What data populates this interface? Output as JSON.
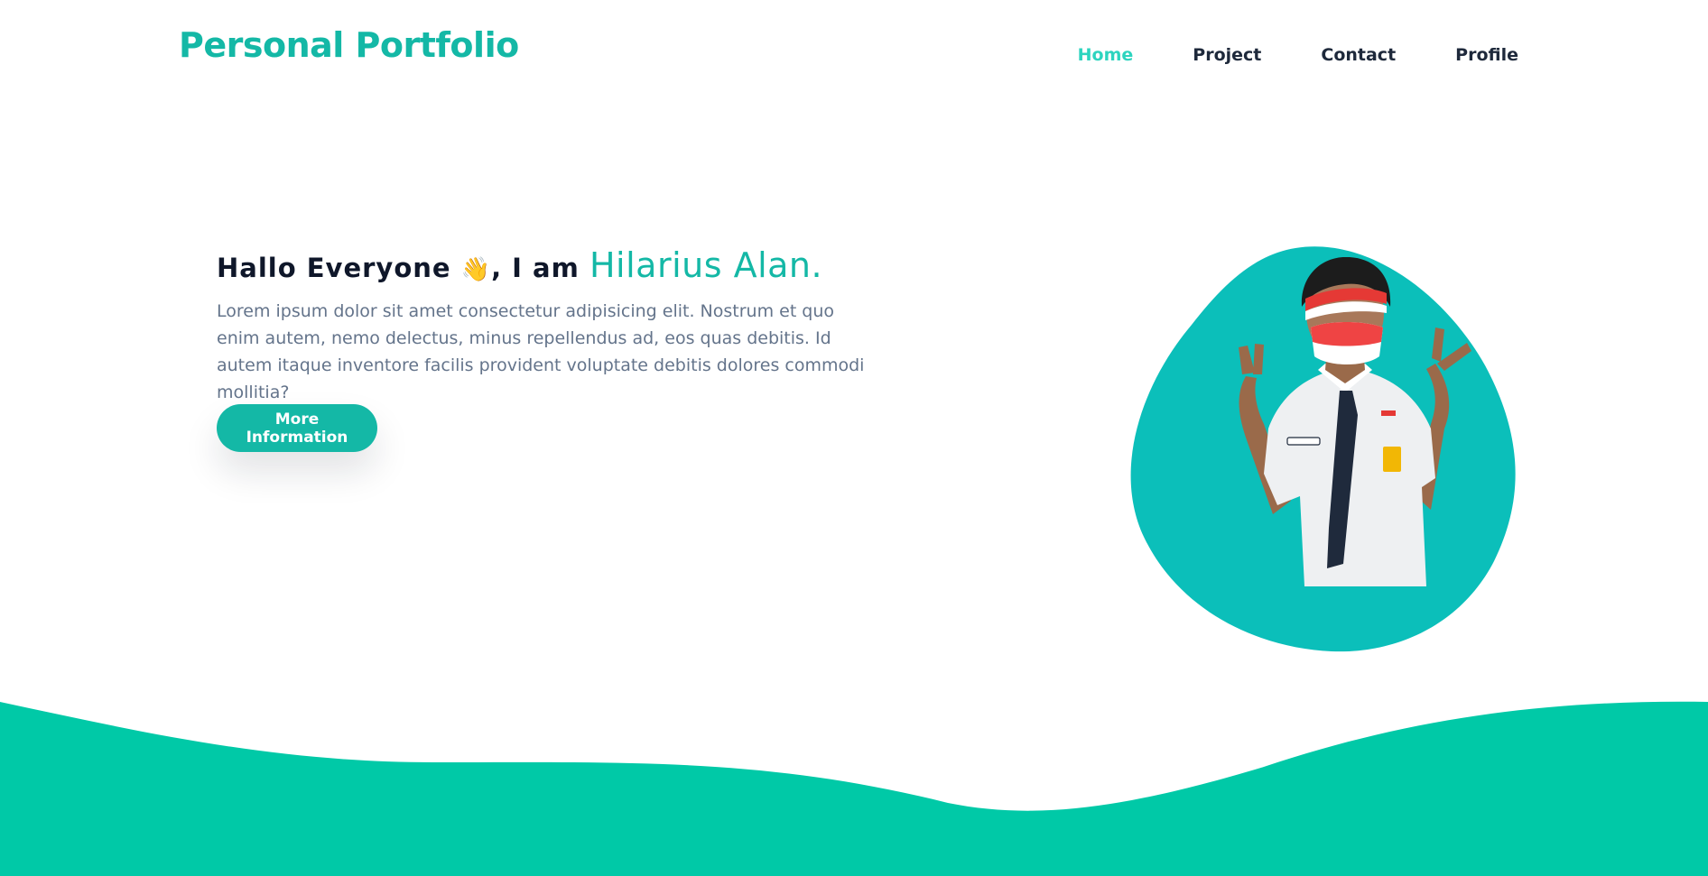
{
  "header": {
    "brand": "Personal Portfolio",
    "nav": [
      {
        "label": "Home",
        "active": true
      },
      {
        "label": "Project",
        "active": false
      },
      {
        "label": "Contact",
        "active": false
      },
      {
        "label": "Profile",
        "active": false
      }
    ]
  },
  "hero": {
    "greeting_prefix": "Hallo Everyone",
    "wave_emoji": "👋",
    "greeting_mid": ", I am",
    "name": "Hilarius Alan.",
    "description": "Lorem ipsum dolor sit amet consectetur adipisicing elit. Nostrum et quo enim autem, nemo delectus, minus repellendus ad, eos quas debitis. Id autem itaque inventore facilis provident voluptate debitis dolores commodi mollitia?",
    "cta_label": "More Information"
  },
  "colors": {
    "accent": "#14b8a6",
    "nav_active": "#2dd4bf",
    "blob": "#0bbfba",
    "wave": "#00c9a7"
  },
  "icons": {
    "wave": "waving-hand-icon"
  }
}
